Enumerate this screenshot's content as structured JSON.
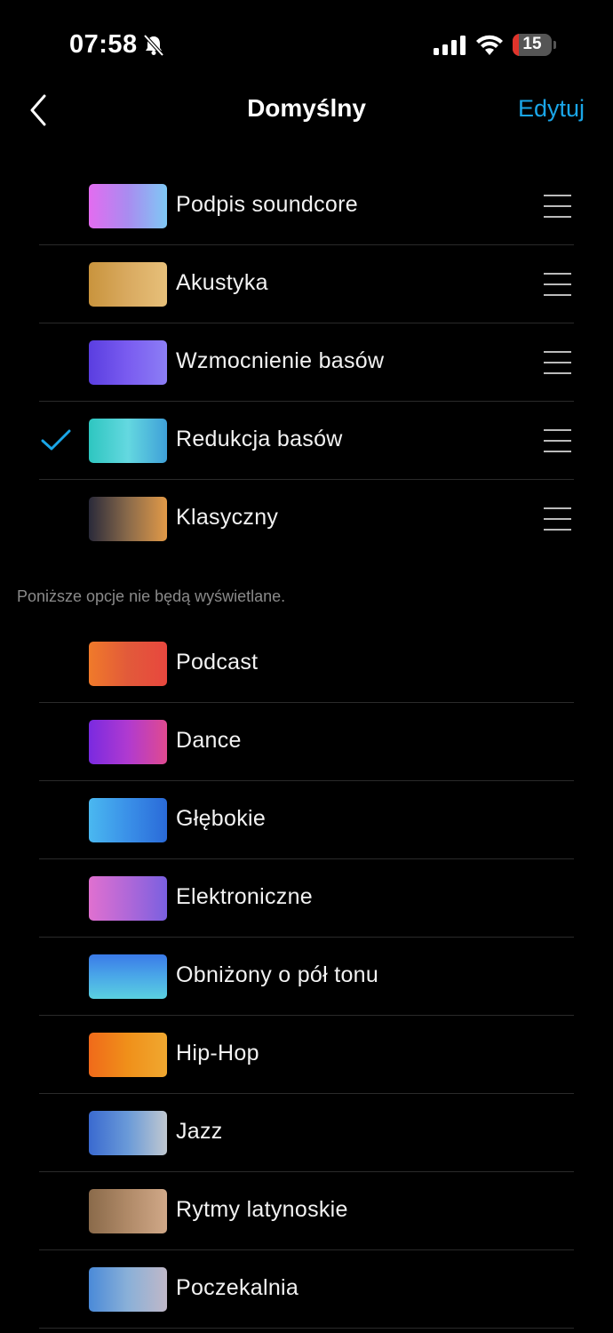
{
  "status": {
    "time": "07:58",
    "battery": "15",
    "battery_level": 0.15
  },
  "nav": {
    "title": "Domyślny",
    "edit_label": "Edytuj"
  },
  "colors": {
    "accent": "#1aa6e8",
    "background": "#000000"
  },
  "visible_presets": [
    {
      "label": "Podpis soundcore",
      "selected": false,
      "thumb": "linear-gradient(90deg,#e36cf0,#a98cf0,#7fc8f5)"
    },
    {
      "label": "Akustyka",
      "selected": false,
      "thumb": "linear-gradient(90deg,#c9943d,#d9aa60,#e7c07a)"
    },
    {
      "label": "Wzmocnienie basów",
      "selected": false,
      "thumb": "linear-gradient(90deg,#5a3ee0,#7a5cf0,#8c7ef5)"
    },
    {
      "label": "Redukcja basów",
      "selected": true,
      "thumb": "linear-gradient(90deg,#2ec6c0,#64d8e0,#3fa0d8)"
    },
    {
      "label": "Klasyczny",
      "selected": false,
      "thumb": "linear-gradient(90deg,#2a2a3a,#8a6a4a,#e29a48)"
    }
  ],
  "hidden_note": "Poniższe opcje nie będą wyświetlane.",
  "hidden_presets": [
    {
      "label": "Podcast",
      "thumb": "linear-gradient(90deg,#f07a2a,#e25a3a,#e8473e)"
    },
    {
      "label": "Dance",
      "thumb": "linear-gradient(90deg,#7a2ae0,#b03ad0,#e04a90)"
    },
    {
      "label": "Głębokie",
      "thumb": "linear-gradient(90deg,#4ab8f0,#3a90e8,#2a6ad8)"
    },
    {
      "label": "Elektroniczne",
      "thumb": "linear-gradient(90deg,#e070d0,#b068d8,#7a60e0)"
    },
    {
      "label": "Obniżony o pół tonu",
      "thumb": "linear-gradient(180deg,#3a7ae8,#4aa8e8,#5ad0e0)"
    },
    {
      "label": "Hip-Hop",
      "thumb": "linear-gradient(90deg,#f06a1a,#f0901a,#f0a830)"
    },
    {
      "label": "Jazz",
      "thumb": "linear-gradient(90deg,#3a6ad0,#6a9ad8,#c0c8d0)"
    },
    {
      "label": "Rytmy latynoskie",
      "thumb": "linear-gradient(90deg,#8a6a4a,#b08a68,#d0a888)"
    },
    {
      "label": "Poczekalnia",
      "thumb": "linear-gradient(90deg,#4a8ad8,#8ab0d8,#c0b8c8)"
    }
  ]
}
